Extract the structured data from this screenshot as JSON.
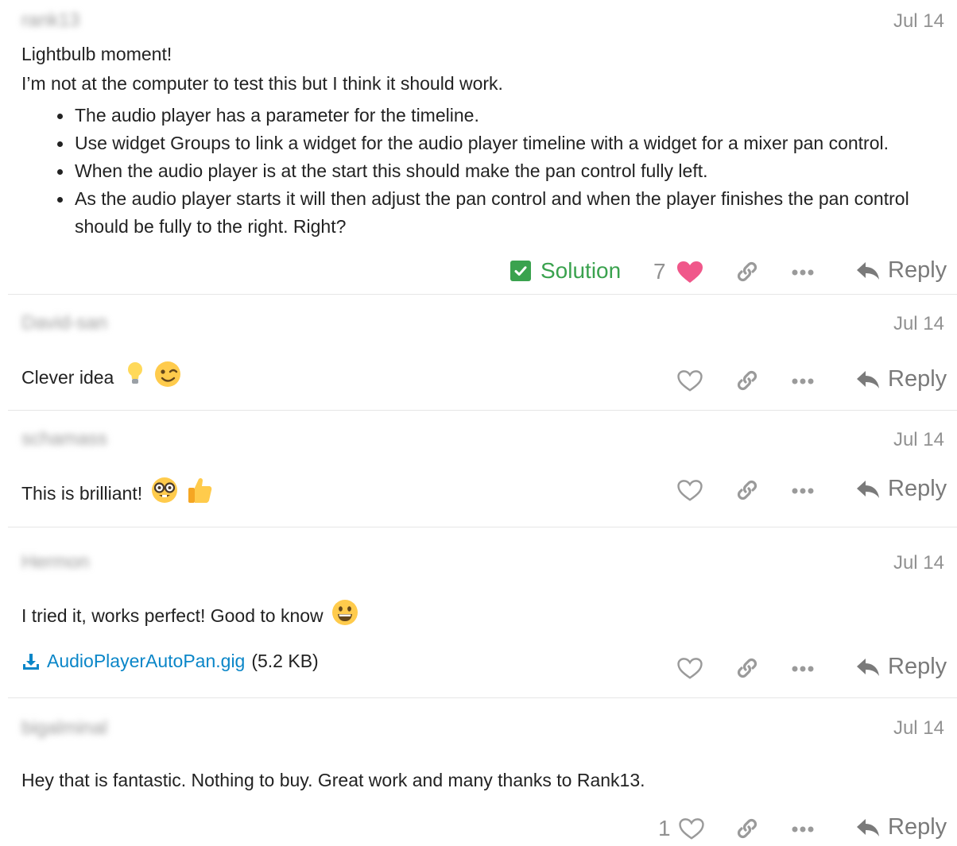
{
  "posts": [
    {
      "author": "rank13",
      "date": "Jul 14",
      "lines": [
        "Lightbulb moment!",
        "I’m not at the computer to test this but I think it should work."
      ],
      "bullets": [
        "The audio player has a parameter for the timeline.",
        "Use widget Groups to link a widget for the audio player timeline with a widget for a mixer pan control.",
        "When the audio player is at the start this should make the pan control fully left.",
        "As the audio player starts it will then adjust the pan control and when the player finishes the pan control should be fully to the right. Right?"
      ],
      "solution_label": "Solution",
      "like_count": "7",
      "liked": true,
      "reply_label": "Reply"
    },
    {
      "author": "David-san",
      "date": "Jul 14",
      "text": "Clever idea",
      "emojis": [
        "light-bulb",
        "winking-face"
      ],
      "reply_label": "Reply"
    },
    {
      "author": "schamass",
      "date": "Jul 14",
      "text": "This is brilliant!",
      "emojis": [
        "nerd-face",
        "thumbs-up"
      ],
      "reply_label": "Reply"
    },
    {
      "author": "Hermon",
      "date": "Jul 14",
      "text": "I tried it, works perfect! Good to know",
      "emojis": [
        "grinning-face"
      ],
      "attachment": {
        "name": "AudioPlayerAutoPan.gig",
        "size": "(5.2 KB)"
      },
      "reply_label": "Reply"
    },
    {
      "author": "bigalminal",
      "date": "Jul 14",
      "text": "Hey that is fantastic. Nothing to buy. Great work and many thanks to Rank13.",
      "like_count": "1",
      "reply_label": "Reply"
    }
  ],
  "colors": {
    "solution": "#3aa24e",
    "liked_heart": "#f0578a",
    "link": "#0a86c8",
    "muted": "#919191"
  }
}
